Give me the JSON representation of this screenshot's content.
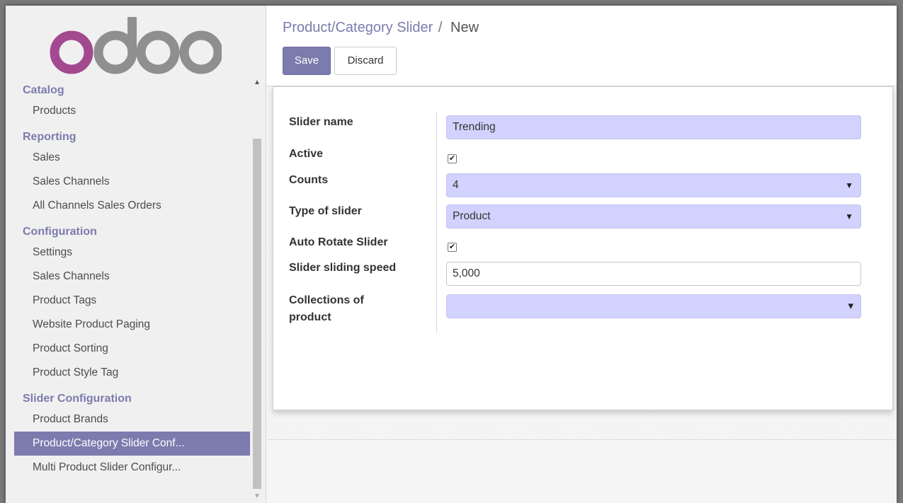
{
  "logo": {
    "text": "odoo"
  },
  "sidebar": {
    "sections": [
      {
        "title": "Catalog",
        "items": [
          "Products"
        ]
      },
      {
        "title": "Reporting",
        "items": [
          "Sales",
          "Sales Channels",
          "All Channels Sales Orders"
        ]
      },
      {
        "title": "Configuration",
        "items": [
          "Settings",
          "Sales Channels",
          "Product Tags",
          "Website Product Paging",
          "Product Sorting",
          "Product Style Tag"
        ]
      },
      {
        "title": "Slider Configuration",
        "items": [
          "Product Brands",
          "Product/Category Slider Conf...",
          "Multi Product Slider Configur..."
        ]
      }
    ],
    "active_item": "Product/Category Slider Conf..."
  },
  "breadcrumb": {
    "parent": "Product/Category Slider",
    "separator": "/",
    "current": "New"
  },
  "buttons": {
    "save": "Save",
    "discard": "Discard"
  },
  "form": {
    "slider_name": {
      "label": "Slider name",
      "value": "Trending"
    },
    "active": {
      "label": "Active",
      "checked": true
    },
    "counts": {
      "label": "Counts",
      "value": "4"
    },
    "type_of_slider": {
      "label": "Type of slider",
      "value": "Product"
    },
    "auto_rotate": {
      "label": "Auto Rotate Slider",
      "checked": true
    },
    "sliding_speed": {
      "label": "Slider sliding speed",
      "value": "5,000"
    },
    "collections": {
      "label_line1": "Collections of",
      "label_line2": "product",
      "value": ""
    }
  },
  "icons": {
    "checkmark": "✔",
    "select_caret": "▼",
    "dropdown_caret": "▾",
    "scroll_up": "▲",
    "scroll_down": "▼"
  },
  "colors": {
    "brand": "#7c7bad",
    "required_field": "#d2d2ff",
    "logo_o1": "#a3498f",
    "logo_rest": "#8f8f8f"
  }
}
